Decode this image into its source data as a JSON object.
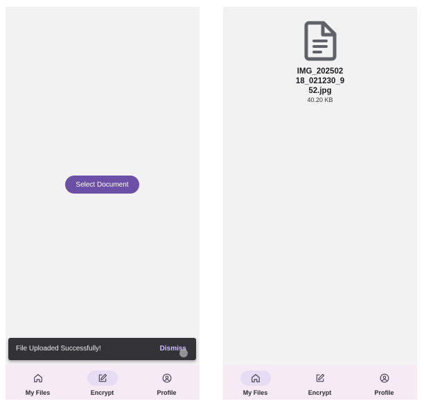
{
  "left_screen": {
    "select_button_label": "Select Document",
    "snackbar": {
      "message": "File Uploaded Successfully!",
      "action_label": "Dismiss"
    },
    "nav": {
      "items": [
        {
          "label": "My Files",
          "icon": "home-icon",
          "active": false
        },
        {
          "label": "Encrypt",
          "icon": "edit-icon",
          "active": true
        },
        {
          "label": "Profile",
          "icon": "profile-icon",
          "active": false
        }
      ]
    }
  },
  "right_screen": {
    "file": {
      "name": "IMG_20250218_021230_952.jpg",
      "size": "40.20 KB",
      "icon": "document-icon"
    },
    "nav": {
      "items": [
        {
          "label": "My Files",
          "icon": "home-icon",
          "active": true
        },
        {
          "label": "Encrypt",
          "icon": "edit-icon",
          "active": false
        },
        {
          "label": "Profile",
          "icon": "profile-icon",
          "active": false
        }
      ]
    }
  },
  "colors": {
    "primary": "#6c4fa7",
    "nav_background": "#f6ebf4",
    "active_pill": "#e6dcf3",
    "snackbar_background": "#333236",
    "snackbar_action": "#d0bcff",
    "screen_background": "#f3f2f3"
  }
}
